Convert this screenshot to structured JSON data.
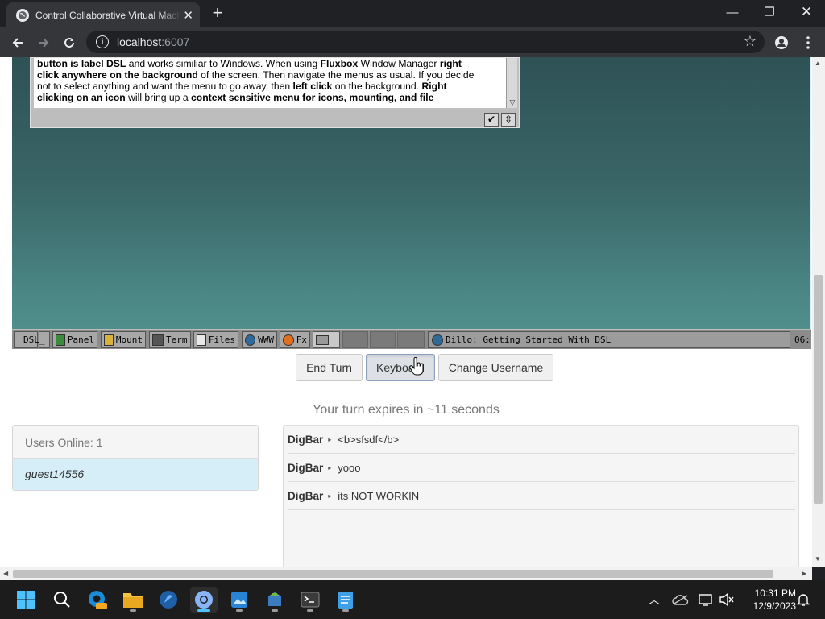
{
  "browser": {
    "tab_title": "Control Collaborative Virtual Machine",
    "url_host": "localhost",
    "url_port": ":6007"
  },
  "vm": {
    "dillo_lines": [
      {
        "parts": [
          [
            "b",
            "button is label DSL"
          ],
          [
            "n",
            " and works similiar to Windows. When using "
          ],
          [
            "b",
            "Fluxbox"
          ],
          [
            "n",
            " Window Manager "
          ],
          [
            "b",
            "right"
          ]
        ]
      },
      {
        "parts": [
          [
            "b",
            "click anywhere on the background"
          ],
          [
            "n",
            " of the screen. Then navigate the menus as usual. If you decide"
          ]
        ]
      },
      {
        "parts": [
          [
            "n",
            "not to select anything and want the menu to go away, then "
          ],
          [
            "b",
            "left click"
          ],
          [
            "n",
            " on the background. "
          ],
          [
            "b",
            "Right"
          ]
        ]
      },
      {
        "parts": [
          [
            "b",
            "clicking on an icon"
          ],
          [
            "n",
            " will bring up a "
          ],
          [
            "b",
            "context sensitive menu for icons, mounting, and file"
          ]
        ]
      }
    ],
    "taskbar_items": [
      "DSL",
      "Panel",
      "Mount",
      "Term",
      "Files",
      "WWW",
      "Fx"
    ],
    "task_title": "Dillo: Getting Started With DSL",
    "clock": "06:"
  },
  "controls": {
    "end_turn": "End Turn",
    "keyboard": "Keyboard",
    "change_username": "Change Username"
  },
  "turn_message": "Your turn expires in ~11 seconds",
  "users": {
    "header": "Users Online: 1",
    "list": [
      "guest14556"
    ]
  },
  "chat": [
    {
      "user": "DigBar",
      "message": "<b>sfsdf</b>"
    },
    {
      "user": "DigBar",
      "message": "yooo"
    },
    {
      "user": "DigBar",
      "message": "its NOT WORKIN"
    }
  ],
  "system": {
    "time": "10:31 PM",
    "date": "12/9/2023"
  }
}
